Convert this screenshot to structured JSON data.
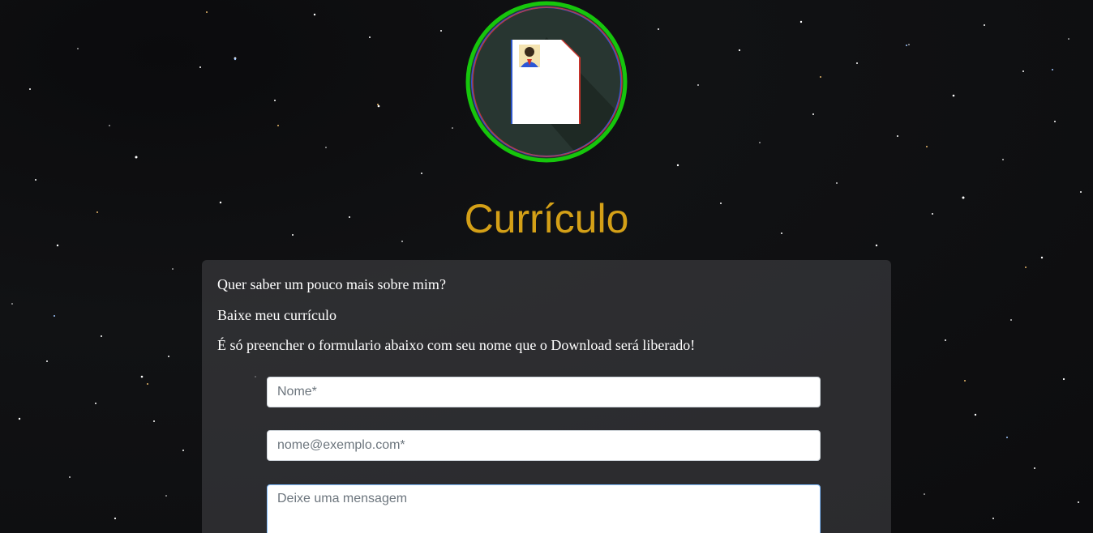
{
  "page": {
    "title": "Currículo"
  },
  "logo": {
    "icon": "resume-document-icon",
    "ring_color": "#16c60c"
  },
  "intro": {
    "line1": "Quer saber um pouco mais sobre mim?",
    "line2": "Baixe meu currículo",
    "line3": "É só preencher o formulario abaixo com seu nome que o Download será liberado!"
  },
  "form": {
    "name_placeholder": "Nome*",
    "email_placeholder": "nome@exemplo.com*",
    "message_placeholder": "Deixe uma mensagem"
  },
  "colors": {
    "title": "#d4a017",
    "background": "#0e0f11"
  }
}
